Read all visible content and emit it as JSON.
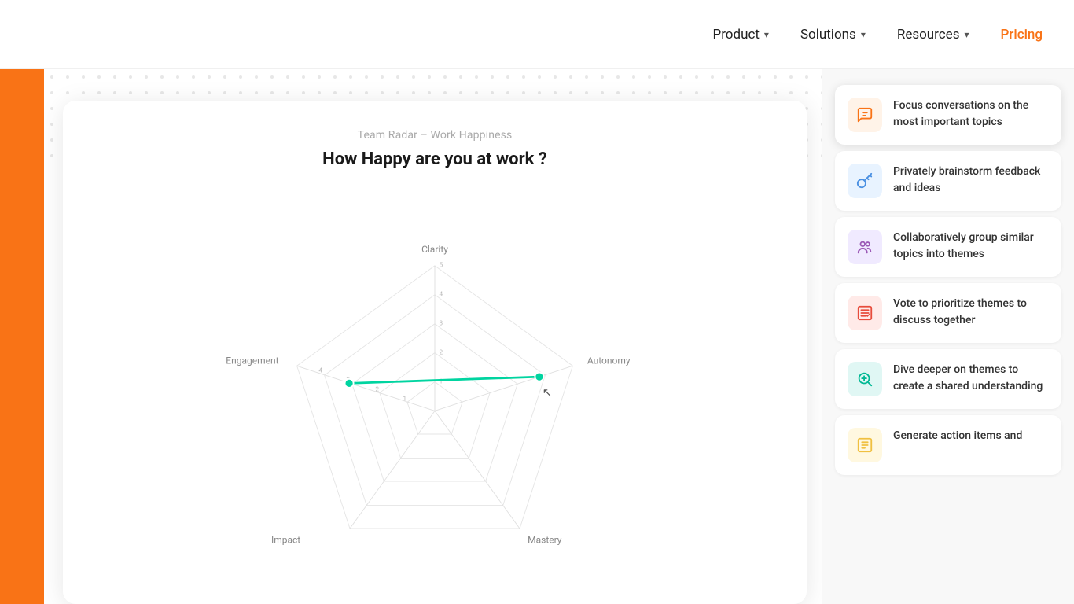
{
  "nav": {
    "items": [
      {
        "label": "Product",
        "hasChevron": true
      },
      {
        "label": "Solutions",
        "hasChevron": true
      },
      {
        "label": "Resources",
        "hasChevron": true
      },
      {
        "label": "Pricing",
        "hasChevron": false
      }
    ]
  },
  "radar": {
    "subtitle": "Team Radar – Work Happiness",
    "title": "How Happy are you at work ?",
    "axes": [
      "Clarity",
      "Autonomy",
      "Mastery",
      "Impact",
      "Engagement"
    ],
    "levels": 5
  },
  "features": [
    {
      "id": "focus-conversations",
      "iconColor": "orange-light",
      "iconSymbol": "💬",
      "text": "Focus conversations on the most important topics",
      "active": true
    },
    {
      "id": "brainstorm",
      "iconColor": "blue-light",
      "iconSymbol": "🔑",
      "text": "Privately brainstorm feedback and ideas"
    },
    {
      "id": "group-topics",
      "iconColor": "purple-light",
      "iconSymbol": "👥",
      "text": "Collaboratively group similar topics into themes"
    },
    {
      "id": "vote-prioritize",
      "iconColor": "salmon-light",
      "iconSymbol": "📋",
      "text": "Vote to prioritize themes to discuss together"
    },
    {
      "id": "dive-deeper",
      "iconColor": "teal-light",
      "iconSymbol": "🔍",
      "text": "Dive deeper on themes to create a shared understanding"
    },
    {
      "id": "generate-actions",
      "iconColor": "yellow-light",
      "iconSymbol": "⚡",
      "text": "Generate action items and"
    }
  ]
}
